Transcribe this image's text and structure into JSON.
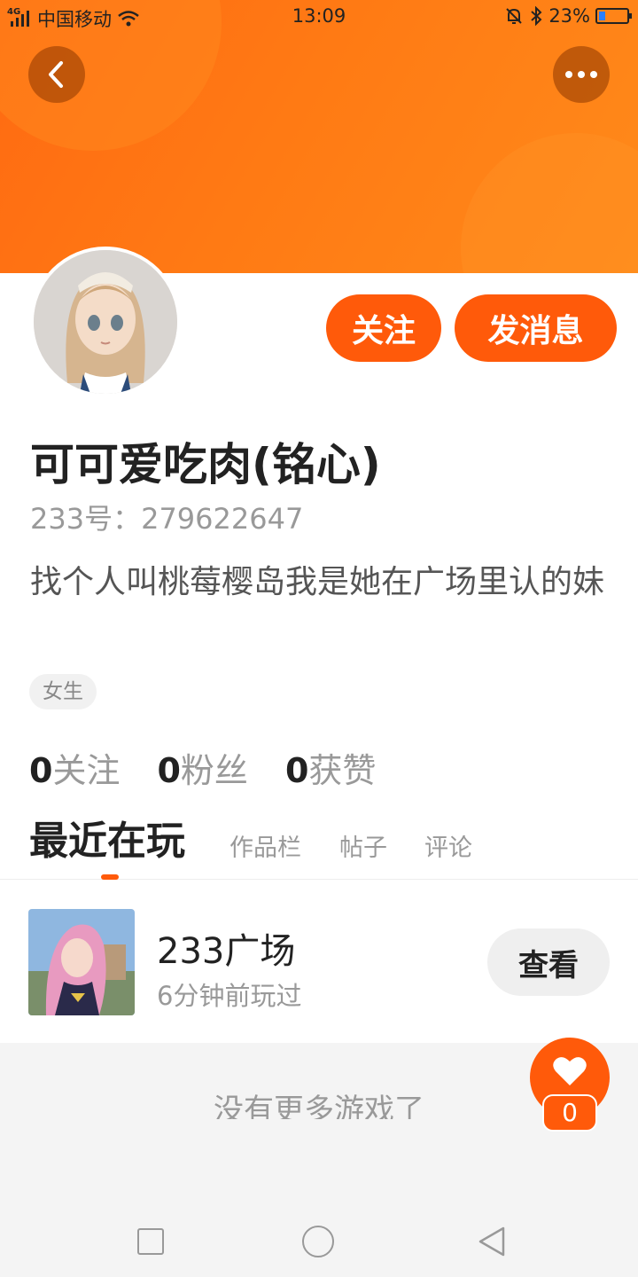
{
  "status_bar": {
    "network": "4G",
    "carrier": "中国移动",
    "time": "13:09",
    "battery_percent": "23%",
    "battery_level": 0.23
  },
  "header": {
    "back_icon": "chevron-left-icon",
    "more_icon": "more-dots-icon",
    "colors": {
      "primary": "#ff5a0a",
      "header_start": "#ff6a12",
      "header_end": "#ff8a1a"
    }
  },
  "profile": {
    "nickname": "可可爱吃肉(铭心)",
    "uid": "233号：279622647",
    "bio": "找个人叫桃莓樱岛我是她在广场里认的妹",
    "gender_tag": "女生",
    "follow_label": "关注",
    "message_label": "发消息",
    "stats": [
      {
        "value": "0",
        "label": "关注"
      },
      {
        "value": "0",
        "label": "粉丝"
      },
      {
        "value": "0",
        "label": "获赞"
      }
    ]
  },
  "tabs": [
    {
      "label": "最近在玩",
      "active": true
    },
    {
      "label": "作品栏",
      "active": false
    },
    {
      "label": "帖子",
      "active": false
    },
    {
      "label": "评论",
      "active": false
    }
  ],
  "games": [
    {
      "name": "233广场",
      "played": "6分钟前玩过",
      "action": "查看"
    }
  ],
  "list_footer": "没有更多游戏了",
  "like": {
    "count": "0",
    "icon": "heart-icon"
  },
  "navbar": {
    "icons": [
      "square-icon",
      "circle-home-icon",
      "triangle-back-icon"
    ]
  }
}
